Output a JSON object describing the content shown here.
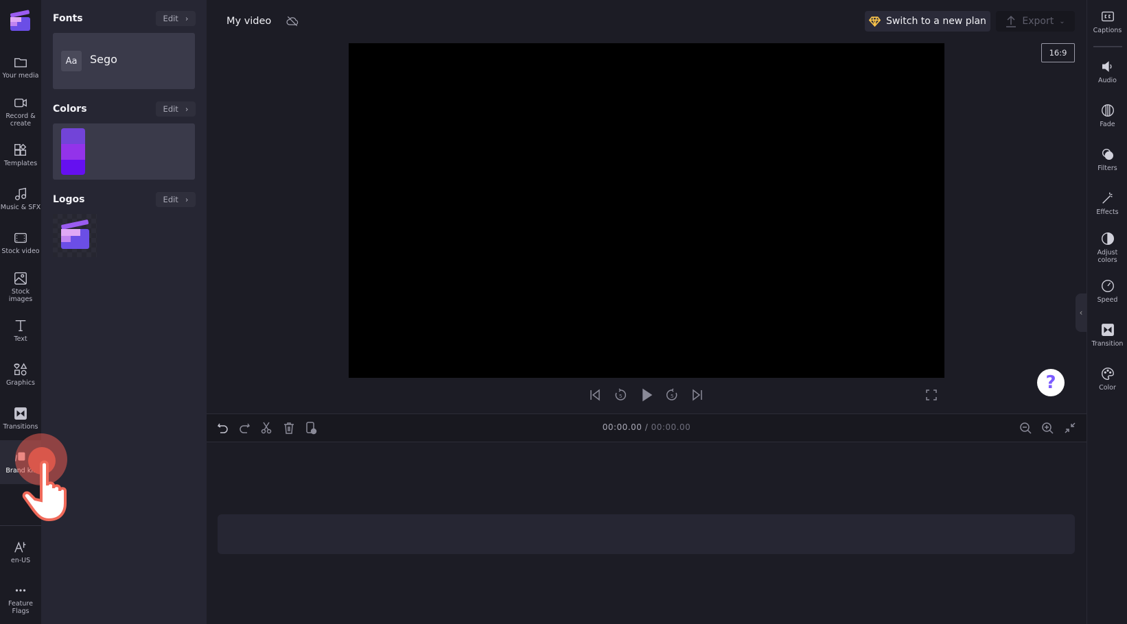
{
  "left_rail": {
    "items": [
      {
        "label": "Your media",
        "icon": "folder-icon"
      },
      {
        "label": "Record & create",
        "icon": "video-camera-icon"
      },
      {
        "label": "Templates",
        "icon": "templates-icon"
      },
      {
        "label": "Music & SFX",
        "icon": "music-note-icon"
      },
      {
        "label": "Stock video",
        "icon": "film-icon"
      },
      {
        "label": "Stock images",
        "icon": "image-icon"
      },
      {
        "label": "Text",
        "icon": "text-icon"
      },
      {
        "label": "Graphics",
        "icon": "shapes-icon"
      },
      {
        "label": "Transitions",
        "icon": "transition-icon"
      },
      {
        "label": "Brand kit",
        "icon": "brand-kit-icon",
        "active": true
      }
    ],
    "bottom": [
      {
        "label": "en-US",
        "icon": "language-icon"
      },
      {
        "label": "Feature Flags",
        "icon": "more-icon"
      }
    ]
  },
  "panel": {
    "fonts": {
      "title": "Fonts",
      "edit": "Edit",
      "sample": "Aa",
      "font_name": "Sego"
    },
    "colors": {
      "title": "Colors",
      "edit": "Edit",
      "swatches": [
        "#7244d8",
        "#9333ea",
        "#6510f0"
      ]
    },
    "logos": {
      "title": "Logos",
      "edit": "Edit"
    }
  },
  "topbar": {
    "project_title": "My video",
    "upgrade": "Switch to a new plan",
    "export": "Export"
  },
  "preview": {
    "aspect": "16:9",
    "help": "?"
  },
  "timeline": {
    "current": "00:00.00",
    "separator": " / ",
    "total": "00:00.00"
  },
  "right_rail": {
    "items": [
      {
        "label": "Captions",
        "icon": "captions-icon"
      },
      {
        "label": "Audio",
        "icon": "speaker-icon"
      },
      {
        "label": "Fade",
        "icon": "fade-icon"
      },
      {
        "label": "Filters",
        "icon": "filters-icon"
      },
      {
        "label": "Effects",
        "icon": "magic-wand-icon"
      },
      {
        "label": "Adjust colors",
        "icon": "contrast-icon"
      },
      {
        "label": "Speed",
        "icon": "speedometer-icon"
      },
      {
        "label": "Transition",
        "icon": "transition-icon"
      },
      {
        "label": "Color",
        "icon": "palette-icon"
      }
    ]
  },
  "colors": {
    "accent": "#7c5cff",
    "upgrade_icon": "#f5c04a"
  }
}
